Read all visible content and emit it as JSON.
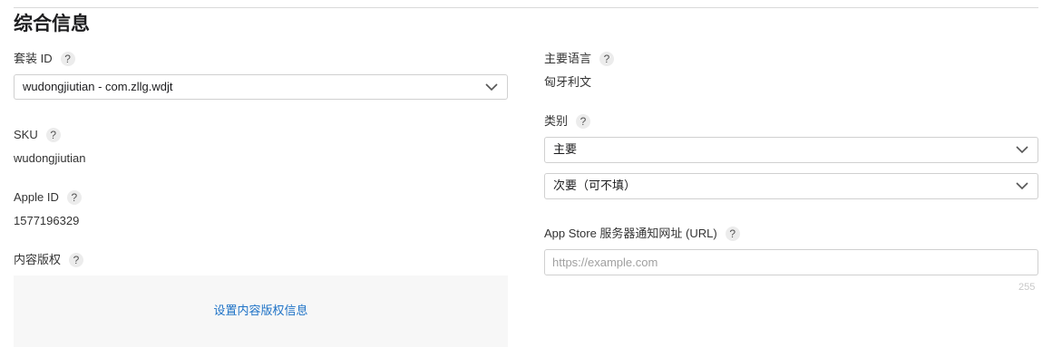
{
  "section": {
    "title": "综合信息"
  },
  "left": {
    "bundle_id": {
      "label": "套装 ID",
      "help": "?",
      "selected": "wudongjiutian - com.zllg.wdjt"
    },
    "sku": {
      "label": "SKU",
      "help": "?",
      "value": "wudongjiutian"
    },
    "apple_id": {
      "label": "Apple ID",
      "help": "?",
      "value": "1577196329"
    },
    "content_rights": {
      "label": "内容版权",
      "help": "?",
      "link": "设置内容版权信息"
    }
  },
  "right": {
    "primary_language": {
      "label": "主要语言",
      "help": "?",
      "value": "匈牙利文"
    },
    "category": {
      "label": "类别",
      "help": "?",
      "primary": "主要",
      "secondary": "次要（可不填）"
    },
    "notification_url": {
      "label": "App Store 服务器通知网址 (URL)",
      "help": "?",
      "placeholder": "https://example.com",
      "value": "",
      "max_length": "255"
    }
  },
  "icons": {
    "help": "question-mark-icon",
    "dropdown": "chevron-down-icon"
  },
  "colors": {
    "link": "#1f73c7",
    "rights_box_bg": "#f7f7f7",
    "border": "#d0d0d0"
  }
}
